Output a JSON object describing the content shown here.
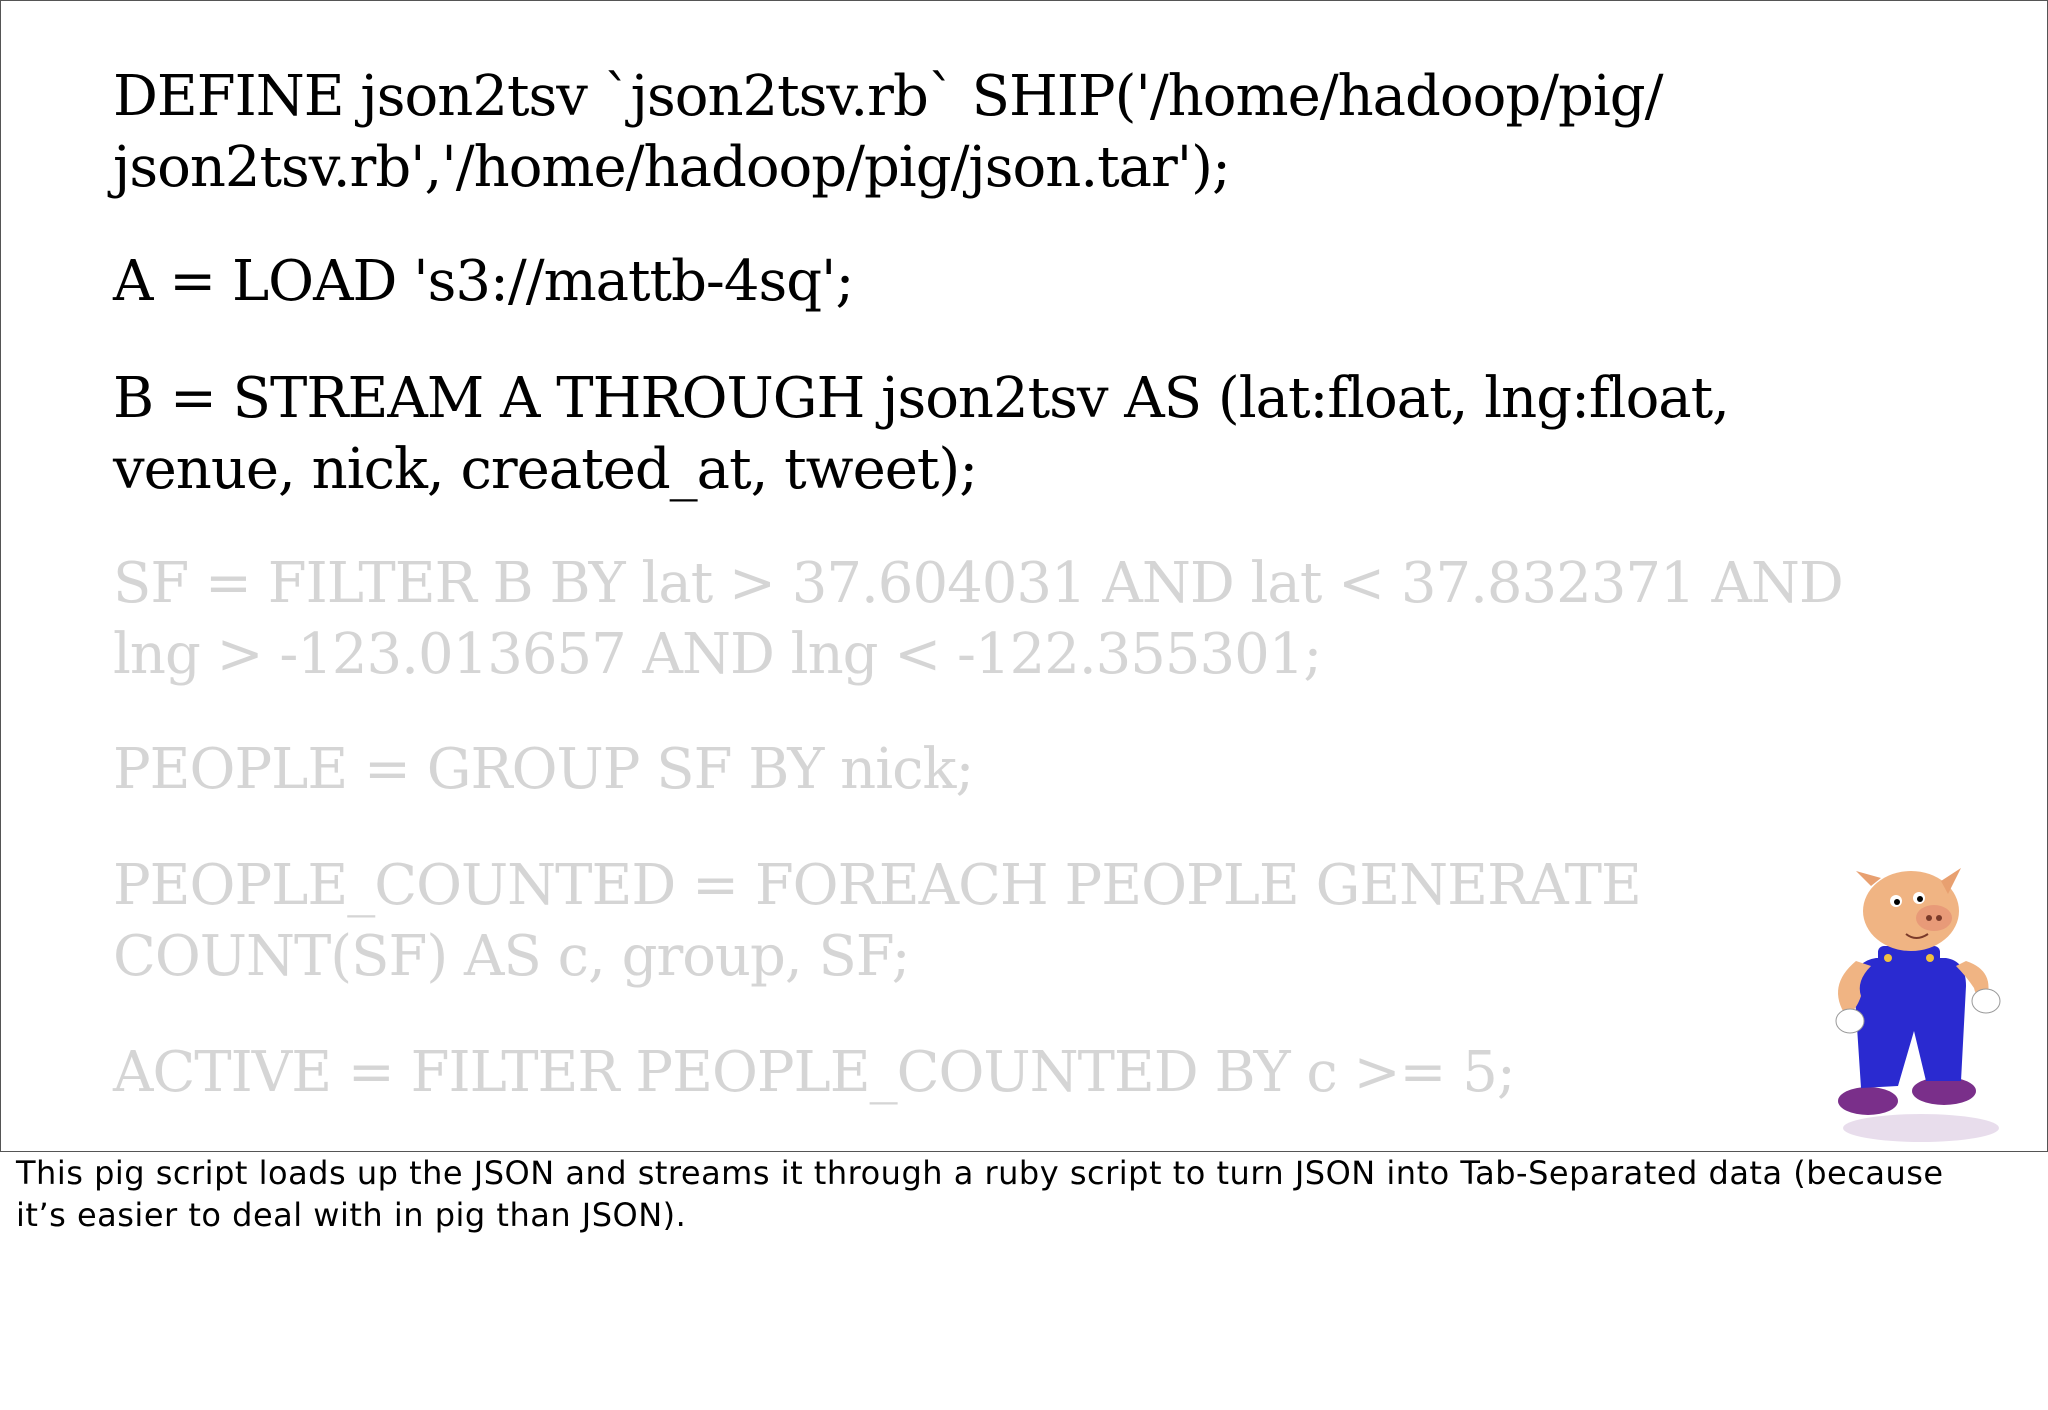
{
  "slide": {
    "code_lines": [
      {
        "text": "DEFINE json2tsv `json2tsv.rb` SHIP('/home/hadoop/pig/",
        "state": "active"
      },
      {
        "text": "json2tsv.rb','/home/hadoop/pig/json.tar');",
        "state": "active"
      },
      {
        "text": "A = LOAD 's3://mattb-4sq';",
        "state": "active"
      },
      {
        "text": "B = STREAM A THROUGH json2tsv AS (lat:float, lng:float,",
        "state": "active"
      },
      {
        "text": "venue, nick, created_at, tweet);",
        "state": "active"
      },
      {
        "text": "SF = FILTER B BY lat > 37.604031 AND lat < 37.832371 AND",
        "state": "dim"
      },
      {
        "text": "lng > -123.013657 AND lng < -122.355301;",
        "state": "dim"
      },
      {
        "text": "PEOPLE = GROUP SF BY nick;",
        "state": "dim"
      },
      {
        "text": "PEOPLE_COUNTED = FOREACH PEOPLE GENERATE",
        "state": "dim"
      },
      {
        "text": "COUNT(SF) AS c, group, SF;",
        "state": "dim"
      },
      {
        "text": "ACTIVE = FILTER PEOPLE_COUNTED BY c >= 5;",
        "state": "dim"
      }
    ],
    "mascot_icon": "pig-mascot-icon"
  },
  "notes": {
    "lines": [
      "This pig script loads up the JSON and streams it through a ruby script to turn JSON into Tab-Separated data (because",
      "it’s easier to deal with in pig than JSON)."
    ]
  },
  "colors": {
    "active_text": "#000000",
    "dim_text": "#d5d5d5",
    "pig_skin": "#f0b483",
    "overalls": "#2a2ad0",
    "shoes": "#7a2f8a"
  }
}
